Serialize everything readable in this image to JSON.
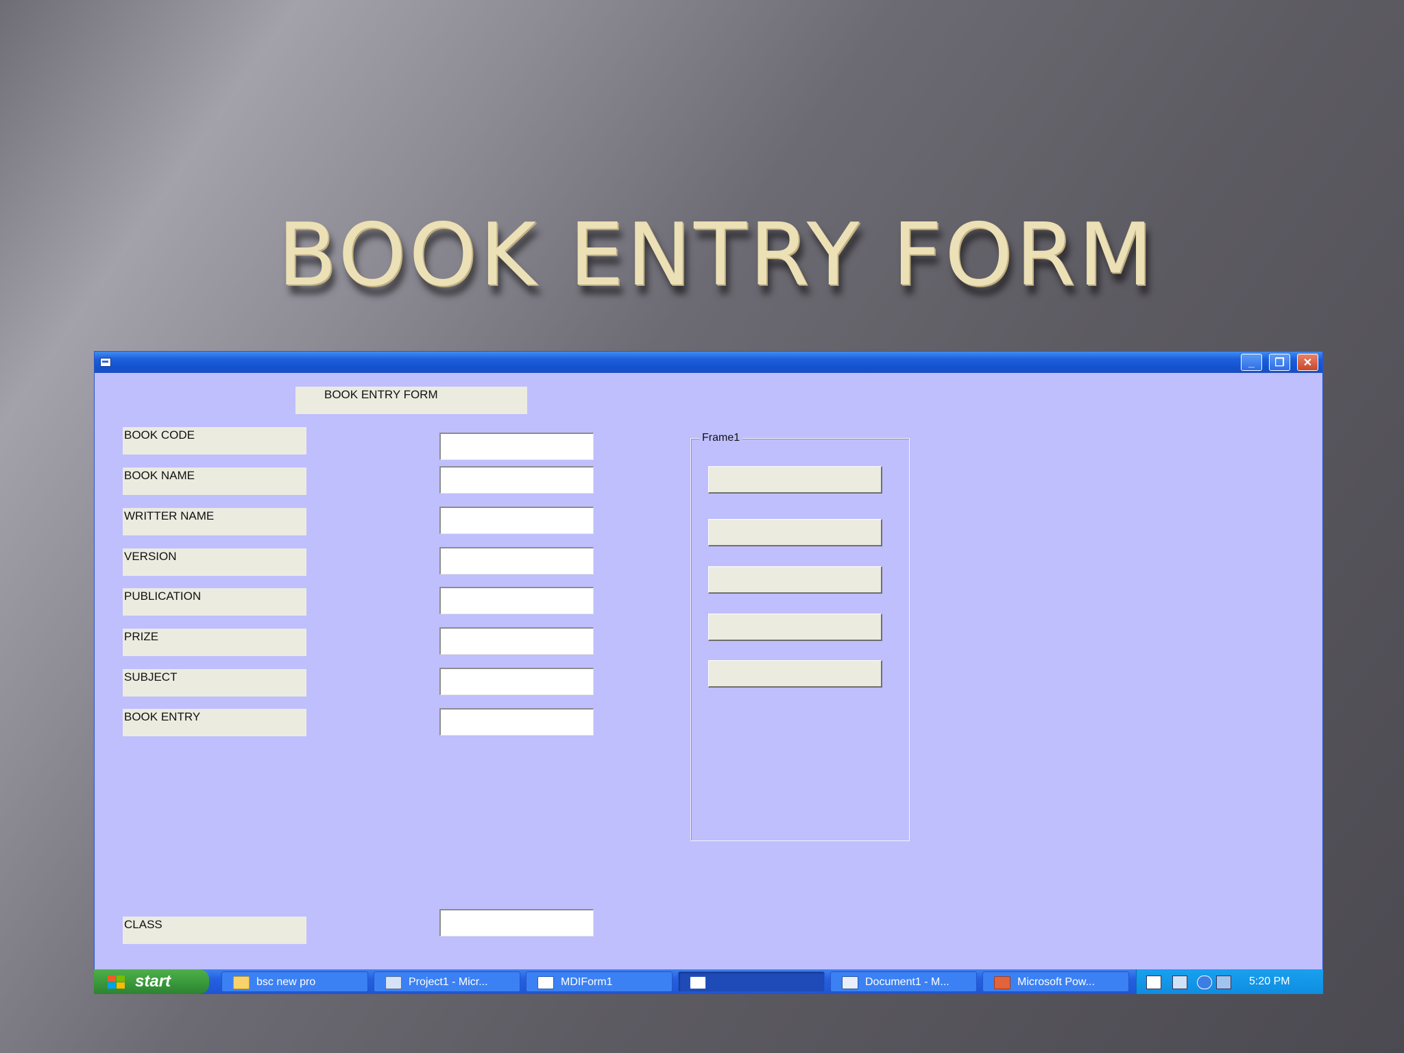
{
  "slide": {
    "title": "BOOK ENTRY FORM"
  },
  "form": {
    "heading": "BOOK ENTRY FORM",
    "fields": [
      {
        "label": "BOOK CODE",
        "value": ""
      },
      {
        "label": "BOOK NAME",
        "value": ""
      },
      {
        "label": "WRITTER NAME",
        "value": ""
      },
      {
        "label": "VERSION",
        "value": ""
      },
      {
        "label": "PUBLICATION",
        "value": ""
      },
      {
        "label": "PRIZE",
        "value": ""
      },
      {
        "label": "SUBJECT",
        "value": ""
      },
      {
        "label": "BOOK ENTRY",
        "value": ""
      },
      {
        "label": "CLASS",
        "value": ""
      }
    ],
    "frame": {
      "caption": "Frame1",
      "buttons": [
        "",
        "",
        "",
        "",
        ""
      ]
    }
  },
  "window": {
    "controls": {
      "minimize": "_",
      "restore": "❐",
      "close": "✕"
    }
  },
  "taskbar": {
    "start_label": "start",
    "tasks": [
      {
        "label": "bsc new pro",
        "icon": "folder-icon"
      },
      {
        "label": "Project1 - Micr...",
        "icon": "vb-project-icon"
      },
      {
        "label": "MDIForm1",
        "icon": "form-window-icon"
      },
      {
        "label": "",
        "icon": "form-window-icon"
      },
      {
        "label": "Document1 - M...",
        "icon": "word-icon"
      },
      {
        "label": "Microsoft Pow...",
        "icon": "powerpoint-icon"
      }
    ],
    "clock": "5:20 PM"
  },
  "colors": {
    "form_background": "#bfbffd",
    "label_background": "#ecebe0",
    "titlebar_blue": "#1d5fdc",
    "title_gold": "#ece0b6",
    "start_green": "#37963a"
  }
}
